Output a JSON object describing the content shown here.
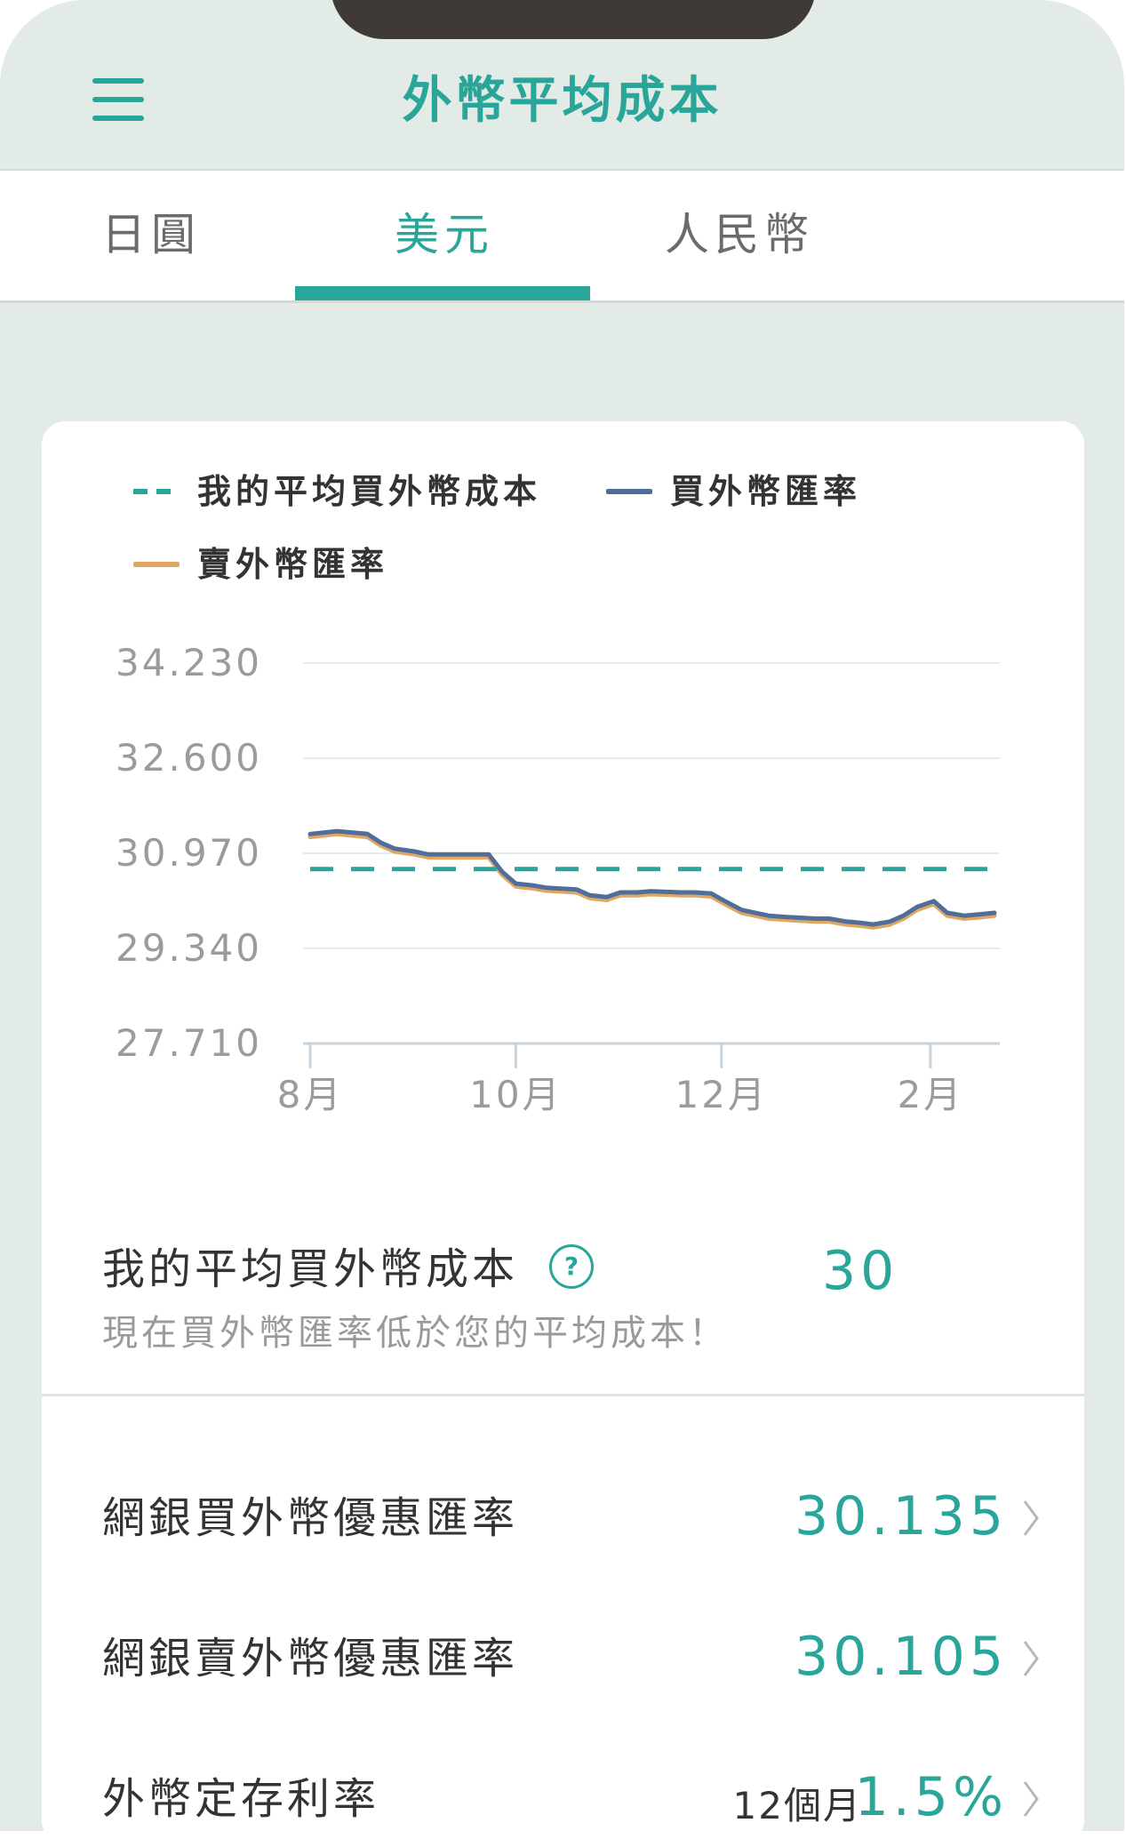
{
  "app": {
    "title": "外幣平均成本"
  },
  "tabs": [
    {
      "label": "日圓",
      "active": false
    },
    {
      "label": "美元",
      "active": true
    },
    {
      "label": "人民幣",
      "active": false
    }
  ],
  "colors": {
    "accent": "#2aa59a",
    "buy_line": "#4f6f9a",
    "sell_line": "#e2a663",
    "background": "#e3ebe6"
  },
  "chart_data": {
    "type": "line",
    "legend": [
      "我的平均買外幣成本",
      "買外幣匯率",
      "賣外幣匯率"
    ],
    "legend_position": "top-left",
    "y_ticks": [
      "34.230",
      "32.600",
      "30.970",
      "29.340",
      "27.710"
    ],
    "ylim": [
      27.71,
      34.23
    ],
    "x_ticks": [
      "8月",
      "10月",
      "12月",
      "2月"
    ],
    "x_tick_days": [
      0,
      61,
      122,
      184
    ],
    "x_range_days": [
      0,
      203
    ],
    "grid": true,
    "series": [
      {
        "name": "我的平均買外幣成本",
        "style": "dashed",
        "color": "#2aa59a",
        "x": [
          0,
          203
        ],
        "y": [
          30.7,
          30.7
        ]
      },
      {
        "name": "買外幣匯率",
        "style": "solid",
        "color": "#4f6f9a",
        "x": [
          0,
          8,
          17,
          21,
          25,
          31,
          35,
          44,
          53,
          57,
          61,
          66,
          70,
          79,
          83,
          88,
          92,
          97,
          101,
          110,
          114,
          119,
          123,
          128,
          132,
          136,
          141,
          150,
          154,
          159,
          163,
          167,
          172,
          176,
          180,
          185,
          189,
          194,
          198,
          203
        ],
        "y": [
          31.3,
          31.35,
          31.3,
          31.15,
          31.05,
          31.0,
          30.95,
          30.95,
          30.95,
          30.65,
          30.45,
          30.42,
          30.38,
          30.35,
          30.25,
          30.22,
          30.3,
          30.3,
          30.32,
          30.3,
          30.3,
          30.28,
          30.15,
          30.0,
          29.95,
          29.9,
          29.88,
          29.85,
          29.85,
          29.8,
          29.78,
          29.75,
          29.8,
          29.9,
          30.05,
          30.15,
          29.95,
          29.9,
          29.92,
          29.95
        ]
      },
      {
        "name": "賣外幣匯率",
        "style": "solid",
        "color": "#e2a663",
        "x": [
          0,
          8,
          17,
          21,
          25,
          31,
          35,
          44,
          53,
          57,
          61,
          66,
          70,
          79,
          83,
          88,
          92,
          97,
          101,
          110,
          114,
          119,
          123,
          128,
          132,
          136,
          141,
          150,
          154,
          159,
          163,
          167,
          172,
          176,
          180,
          185,
          189,
          194,
          198,
          203
        ],
        "y": [
          31.25,
          31.3,
          31.25,
          31.1,
          31.0,
          30.95,
          30.9,
          30.9,
          30.9,
          30.6,
          30.4,
          30.37,
          30.33,
          30.3,
          30.2,
          30.17,
          30.25,
          30.25,
          30.27,
          30.25,
          30.25,
          30.23,
          30.1,
          29.95,
          29.9,
          29.85,
          29.83,
          29.8,
          29.8,
          29.75,
          29.73,
          29.7,
          29.75,
          29.85,
          30.0,
          30.1,
          29.9,
          29.85,
          29.87,
          29.9
        ]
      }
    ]
  },
  "summary": {
    "label": "我的平均買外幣成本",
    "help_icon": "?",
    "value": "30",
    "note": "現在買外幣匯率低於您的平均成本！"
  },
  "rates": [
    {
      "label": "網銀買外幣優惠匯率",
      "prefix": "",
      "value": "30.135"
    },
    {
      "label": "網銀賣外幣優惠匯率",
      "prefix": "",
      "value": "30.105"
    },
    {
      "label": "外幣定存利率",
      "prefix": "12個月",
      "value": "1.5%"
    }
  ],
  "icons": {
    "menu": "hamburger-menu-icon",
    "help": "question-circle-icon",
    "chevron": "chevron-right-icon"
  }
}
